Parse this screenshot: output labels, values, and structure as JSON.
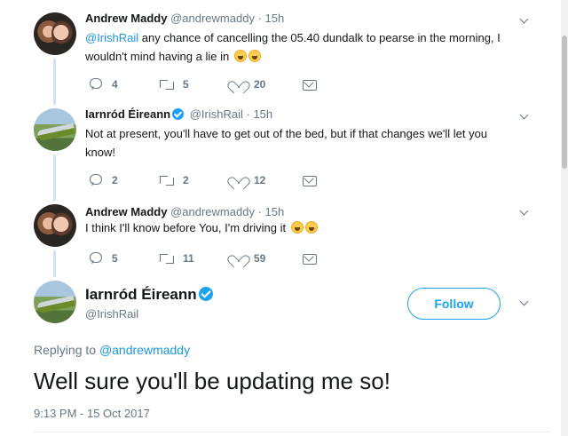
{
  "tweets": [
    {
      "name": "Andrew Maddy",
      "handle": "@andrewmaddy",
      "dot": "·",
      "time": "15h",
      "mention": "@IrishRail",
      "text": " any chance of cancelling the 05.40 dundalk to pearse in the morning, I wouldn't mind having a lie in",
      "replies": "4",
      "retweets": "5",
      "likes": "20"
    },
    {
      "name": "Iarnród Éireann",
      "handle": "@IrishRail",
      "dot": "·",
      "time": "15h",
      "text": "Not at present, you'll have to get out of the bed, but if that changes we'll let you know!",
      "replies": "2",
      "retweets": "2",
      "likes": "12"
    },
    {
      "name": "Andrew Maddy",
      "handle": "@andrewmaddy",
      "dot": "·",
      "time": "15h",
      "text": "I think I'll know before You, I'm driving it",
      "replies": "5",
      "retweets": "11",
      "likes": "59"
    }
  ],
  "main_tweet": {
    "name": "Iarnród Éireann",
    "handle": "@IrishRail",
    "follow_label": "Follow",
    "replying_prefix": "Replying to",
    "replying_to": "@andrewmaddy",
    "text": "Well sure you'll be updating me so!",
    "timestamp": "9:13 PM - 15 Oct 2017"
  },
  "colors": {
    "link": "#1b95e0",
    "accent": "#1da1f2",
    "muted": "#657786",
    "thread_line": "#cfe3f3"
  },
  "icons": {
    "reply": "reply-icon",
    "retweet": "retweet-icon",
    "like": "heart-icon",
    "dm": "envelope-icon",
    "verified": "verified-badge-icon",
    "more": "chevron-down-icon",
    "emoji": "grinning-face-emoji"
  }
}
